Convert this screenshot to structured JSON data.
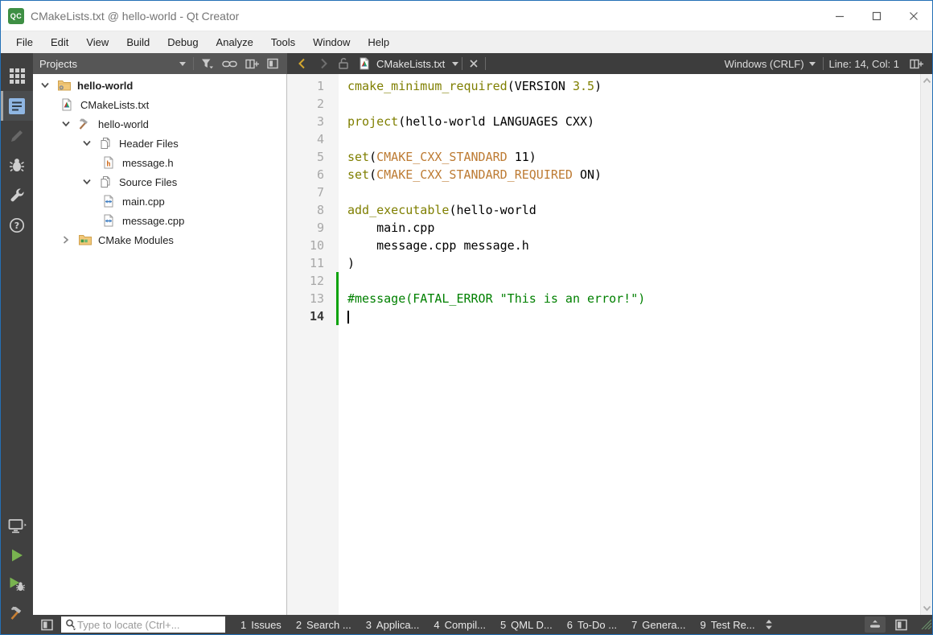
{
  "window": {
    "title": "CMakeLists.txt @ hello-world - Qt Creator",
    "app_badge": "QC"
  },
  "menubar": {
    "items": [
      "File",
      "Edit",
      "View",
      "Build",
      "Debug",
      "Analyze",
      "Tools",
      "Window",
      "Help"
    ]
  },
  "sidebar": {
    "modes": [
      {
        "name": "welcome",
        "icon": "welcome-grid-icon",
        "active": false,
        "disabled": false
      },
      {
        "name": "edit",
        "icon": "edit-mode-icon",
        "active": true,
        "disabled": false
      },
      {
        "name": "design",
        "icon": "design-pencil-icon",
        "active": false,
        "disabled": true
      },
      {
        "name": "debug",
        "icon": "debug-bug-icon",
        "active": false,
        "disabled": false
      },
      {
        "name": "projects",
        "icon": "projects-wrench-icon",
        "active": false,
        "disabled": false
      },
      {
        "name": "help",
        "icon": "help-icon",
        "active": false,
        "disabled": false
      }
    ],
    "actions": [
      {
        "name": "kit-selector",
        "icon": "kit-monitor-icon"
      },
      {
        "name": "run",
        "icon": "run-play-icon"
      },
      {
        "name": "debug-run",
        "icon": "debug-run-icon"
      },
      {
        "name": "build",
        "icon": "build-hammer-icon"
      }
    ]
  },
  "projects_panel": {
    "title": "Projects",
    "toolbar": [
      {
        "name": "pane-dropdown",
        "icon": "caret-down-icon"
      },
      {
        "name": "filter",
        "icon": "filter-icon"
      },
      {
        "name": "synchronize-with-editor",
        "icon": "link-icon"
      },
      {
        "name": "split",
        "icon": "split-icon"
      },
      {
        "name": "close-panel",
        "icon": "close-panel-icon"
      }
    ],
    "tree": [
      {
        "label": "hello-world",
        "depth": 0,
        "chevron": "down",
        "icon": "project-folder-icon",
        "bold": true
      },
      {
        "label": "CMakeLists.txt",
        "depth": 1,
        "chevron": "none",
        "icon": "cmake-file-icon",
        "bold": false
      },
      {
        "label": "hello-world",
        "depth": 1,
        "chevron": "down",
        "icon": "build-target-icon",
        "bold": false
      },
      {
        "label": "Header Files",
        "depth": 2,
        "chevron": "down",
        "icon": "file-group-icon",
        "bold": false
      },
      {
        "label": "message.h",
        "depth": 3,
        "chevron": "none",
        "icon": "header-file-icon",
        "bold": false
      },
      {
        "label": "Source Files",
        "depth": 2,
        "chevron": "down",
        "icon": "file-group-icon",
        "bold": false
      },
      {
        "label": "main.cpp",
        "depth": 3,
        "chevron": "none",
        "icon": "cpp-file-icon",
        "bold": false
      },
      {
        "label": "message.cpp",
        "depth": 3,
        "chevron": "none",
        "icon": "cpp-file-icon",
        "bold": false
      },
      {
        "label": "CMake Modules",
        "depth": 1,
        "chevron": "right",
        "icon": "cmake-modules-icon",
        "bold": false
      }
    ]
  },
  "editor": {
    "tab": {
      "file": "CMakeLists.txt",
      "file_icon": "cmake-file-icon"
    },
    "encoding": "Windows (CRLF)",
    "cursor_position": "Line: 14, Col: 1",
    "code": {
      "current_line": 14,
      "changed_lines": [
        12,
        13,
        14
      ],
      "lines": [
        {
          "n": 1,
          "segs": [
            {
              "t": "cmake_minimum_required",
              "c": "func"
            },
            {
              "t": "(VERSION ",
              "c": "plain"
            },
            {
              "t": "3.5",
              "c": "num"
            },
            {
              "t": ")",
              "c": "plain"
            }
          ]
        },
        {
          "n": 2,
          "segs": []
        },
        {
          "n": 3,
          "segs": [
            {
              "t": "project",
              "c": "func"
            },
            {
              "t": "(hello-world LANGUAGES CXX)",
              "c": "plain"
            }
          ]
        },
        {
          "n": 4,
          "segs": []
        },
        {
          "n": 5,
          "segs": [
            {
              "t": "set",
              "c": "func"
            },
            {
              "t": "(",
              "c": "plain"
            },
            {
              "t": "CMAKE_CXX_STANDARD",
              "c": "var"
            },
            {
              "t": " 11)",
              "c": "plain"
            }
          ]
        },
        {
          "n": 6,
          "segs": [
            {
              "t": "set",
              "c": "func"
            },
            {
              "t": "(",
              "c": "plain"
            },
            {
              "t": "CMAKE_CXX_STANDARD_REQUIRED",
              "c": "var"
            },
            {
              "t": " ON)",
              "c": "plain"
            }
          ]
        },
        {
          "n": 7,
          "segs": []
        },
        {
          "n": 8,
          "segs": [
            {
              "t": "add_executable",
              "c": "func"
            },
            {
              "t": "(hello-world",
              "c": "plain"
            }
          ]
        },
        {
          "n": 9,
          "segs": [
            {
              "t": "    main.cpp",
              "c": "plain"
            }
          ]
        },
        {
          "n": 10,
          "segs": [
            {
              "t": "    message.cpp message.h",
              "c": "plain"
            }
          ]
        },
        {
          "n": 11,
          "segs": [
            {
              "t": ")",
              "c": "plain"
            }
          ]
        },
        {
          "n": 12,
          "segs": []
        },
        {
          "n": 13,
          "segs": [
            {
              "t": "#message(FATAL_ERROR \"This is an error!\")",
              "c": "comment"
            }
          ]
        },
        {
          "n": 14,
          "segs": [],
          "cursor": true
        }
      ]
    }
  },
  "statusbar": {
    "locator_placeholder": "Type to locate (Ctrl+...",
    "panes": [
      {
        "num": "1",
        "label": "Issues"
      },
      {
        "num": "2",
        "label": "Search ..."
      },
      {
        "num": "3",
        "label": "Applica..."
      },
      {
        "num": "4",
        "label": "Compil..."
      },
      {
        "num": "5",
        "label": "QML D..."
      },
      {
        "num": "6",
        "label": "To-Do ..."
      },
      {
        "num": "7",
        "label": "Genera..."
      },
      {
        "num": "9",
        "label": "Test Re..."
      }
    ]
  },
  "colors": {
    "accent_border": "#2470b6",
    "dark_chrome": "#404040",
    "projects_header": "#565656",
    "change_bar_green": "#0ca30c",
    "run_green": "#79b350",
    "code_function": "#7f7f00",
    "code_variable": "#bd7b33",
    "code_comment": "#008000",
    "back_arrow_gold": "#d3a62e"
  }
}
